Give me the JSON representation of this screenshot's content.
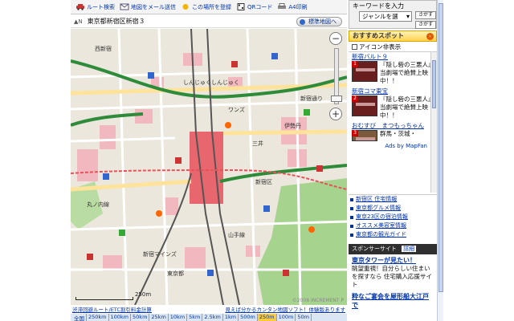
{
  "toolbar": {
    "items": [
      {
        "label": "ルート検索",
        "icon": "car-icon"
      },
      {
        "label": "地図をメール送信",
        "icon": "mail-icon"
      },
      {
        "label": "この場所を登録",
        "icon": "bookmark-icon"
      },
      {
        "label": "QRコード",
        "icon": "qr-icon"
      },
      {
        "label": "A4印刷",
        "icon": "print-icon"
      }
    ]
  },
  "address_row": {
    "north": "▲N",
    "address": "東京都新宿区新宿３",
    "standard_map_label": "標準地図へ"
  },
  "map": {
    "labels": [
      "しんじゅくしんじゅく",
      "ワンズ",
      "三井",
      "伊勢丹",
      "新宿通り",
      "新宿区",
      "西新宿",
      "山手線",
      "新宿マインズ",
      "東京都",
      "丸ノ内線"
    ],
    "scale_label": "250m",
    "attribution": "©2008 INCREMENT P"
  },
  "bottom_links": {
    "left": "渋滞回避ルート/ETC割引料金計算",
    "right": "見えば分かるカンタン地図ソフト！体験版あります"
  },
  "scale_row": {
    "items": [
      "全国",
      "250km",
      "100km",
      "50km",
      "25km",
      "10km",
      "5km",
      "2.5km",
      "1km",
      "500m",
      "250m",
      "100m",
      "50m"
    ],
    "active": "250m"
  },
  "sidebar": {
    "keyword_label": "キーワードを入力",
    "genre_select": "ジャンルを選",
    "search_button": "さがす",
    "search_button2": "さがす",
    "recommend_title": "おすすめスポット",
    "icon_hide_label": "アイコン非表示",
    "spots": [
      {
        "title": "新宿バルト９",
        "badge": "1",
        "desc": "『隠し砦の三悪人』当劇場で絶賛上映中！！"
      },
      {
        "title": "新宿コマ東宝",
        "badge": "2",
        "desc": "『隠し砦の三悪人』当劇場で絶賛上映中！！"
      },
      {
        "title": "おむすび　まつもっちゃん",
        "badge": "3",
        "desc": "群馬・茨城・"
      }
    ],
    "ads_by": "Ads by MapFan",
    "info_links": [
      "新宿区 住宅情報",
      "東京都グルメ情報",
      "東京23区の宿泊情報",
      "オススメ美容室情報",
      "東京都の観光ガイド"
    ],
    "sponsor_header": "スポンサーサイト",
    "sponsor_detail": "詳細",
    "sponsor_ads": [
      {
        "title": "東京タワーが見たい！",
        "text": "眺望重視！自分らしい住まいを探すなら 住宅購入応援サイト"
      },
      {
        "title": "粋なご宴会を屋形船大江戸で",
        "text": ""
      }
    ]
  },
  "colors": {
    "map_bg": "#efece4",
    "railway_red": "#e8505a",
    "highway_green": "#2e8b3a",
    "park_green": "#9ed08a",
    "link_blue": "#0033aa",
    "active_scale": "#ffcc33"
  }
}
